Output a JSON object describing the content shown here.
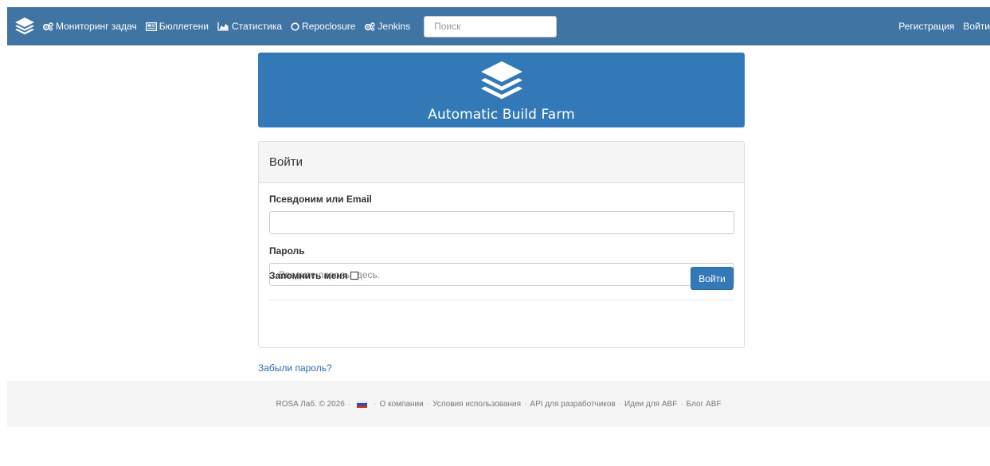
{
  "navbar": {
    "brand_icon": "layers-icon",
    "items": [
      {
        "label": "Мониторинг задач",
        "icon": "gears-icon"
      },
      {
        "label": "Бюллетени",
        "icon": "newspaper-icon"
      },
      {
        "label": "Статистика",
        "icon": "area-chart-icon"
      },
      {
        "label": "Repoclosure",
        "icon": "circle-o-icon"
      },
      {
        "label": "Jenkins",
        "icon": "gears-icon"
      }
    ],
    "search_placeholder": "Поиск",
    "register_label": "Регистрация",
    "login_label": "Войти",
    "color": "#3f74a3"
  },
  "banner": {
    "title": "Automatic Build Farm",
    "logo_icon": "layers-icon",
    "color": "#3379b7"
  },
  "login_form": {
    "heading": "Войти",
    "username_label": "Псевдоним или Email",
    "username_value": "",
    "password_label": "Пароль",
    "password_placeholder": "Введите пароль здесь.",
    "remember_label": "Запомнить меня",
    "remember_checked": false,
    "submit_label": "Войти"
  },
  "forgot_password": "Забыли пароль?",
  "footer": {
    "copyright": "ROSA Лаб. © 2026",
    "flag_icon": "russia-flag-icon",
    "links": [
      "О компании",
      "Условия использования",
      "API для разработчиков",
      "Идеи для ABF",
      "Блог ABF"
    ]
  }
}
